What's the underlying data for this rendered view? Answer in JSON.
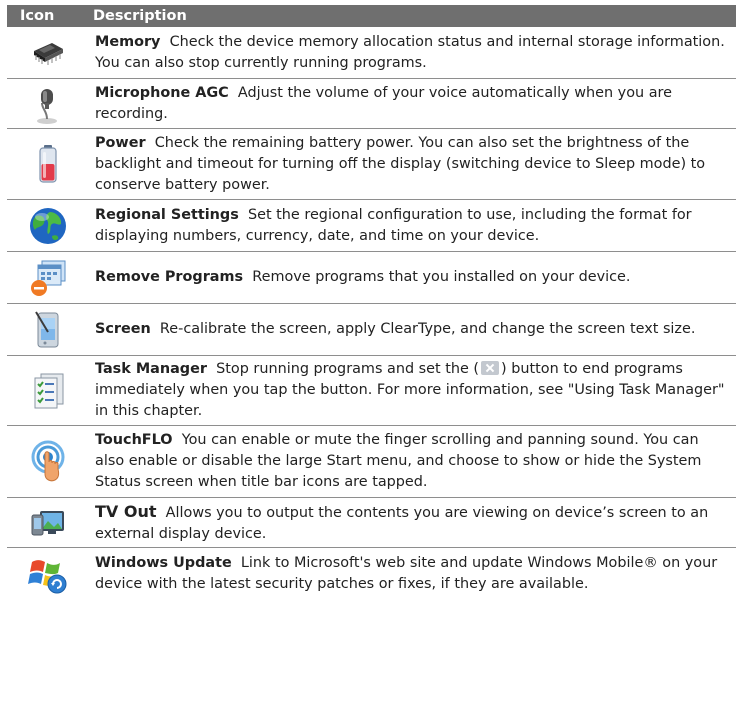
{
  "header": {
    "icon": "Icon",
    "description": "Description"
  },
  "rows": [
    {
      "icon": "memory-chip-icon",
      "name": "Memory",
      "text": "Check the device memory allocation status and internal storage information. You can also stop currently running programs."
    },
    {
      "icon": "microphone-icon",
      "name": "Microphone AGC",
      "text": "Adjust the volume of your voice automatically when you are recording."
    },
    {
      "icon": "battery-icon",
      "name": "Power",
      "text": "Check the remaining battery power. You can also set the brightness of the backlight and timeout for turning off the display (switching device to Sleep mode) to conserve battery power."
    },
    {
      "icon": "globe-icon",
      "name": "Regional Settings",
      "text": "Set the regional configuration to use, including the format for displaying numbers, currency, date, and time on your device."
    },
    {
      "icon": "remove-programs-icon",
      "name": "Remove Programs",
      "text": "Remove programs that you installed on your device."
    },
    {
      "icon": "screen-stylus-icon",
      "name": "Screen",
      "text": "Re-calibrate the screen, apply ClearType, and change the screen text size."
    },
    {
      "icon": "task-manager-icon",
      "name": "Task Manager",
      "text_before": "Stop running programs and set the (",
      "text_after": ") button to end programs immediately when you tap the button. For more information, see \"Using Task Manager\" in this chapter."
    },
    {
      "icon": "touchflo-icon",
      "name": "TouchFLO",
      "text": "You can enable or mute the finger scrolling and panning sound. You can also enable or disable the large Start menu, and choose to show or hide the System Status screen when title bar icons are tapped."
    },
    {
      "icon": "tv-out-icon",
      "name": "TV Out",
      "text": "Allows you to output the contents you are viewing on device’s screen to an external display device."
    },
    {
      "icon": "windows-update-icon",
      "name": "Windows Update",
      "text": "Link to Microsoft's web site and update Windows Mobile® on your device with the latest security patches or fixes, if they are available."
    }
  ]
}
